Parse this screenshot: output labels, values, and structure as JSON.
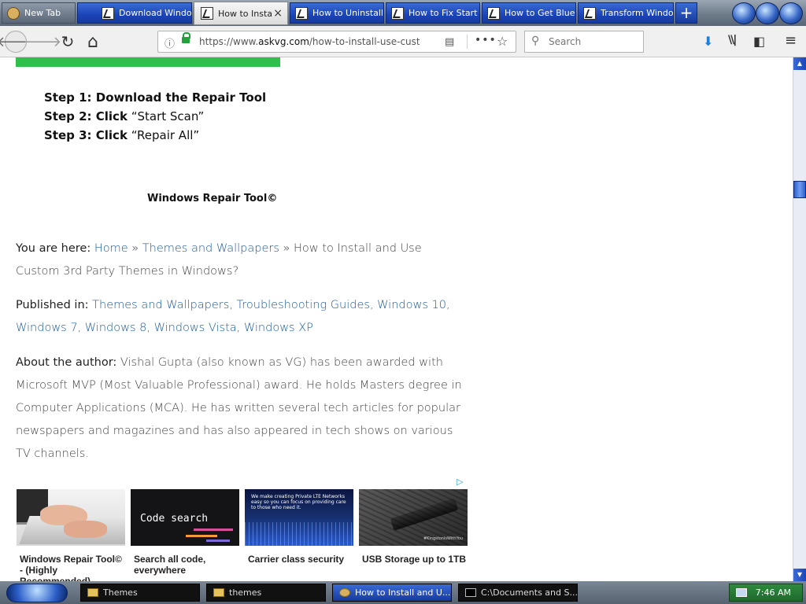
{
  "tabs": [
    {
      "title": "New Tab",
      "favicon": "firefox-icon",
      "state": "inactive-gray"
    },
    {
      "title": "Download Windo",
      "favicon": "askvg-icon",
      "state": "inactive"
    },
    {
      "title": "How to Insta",
      "favicon": "askvg-icon",
      "state": "active",
      "close": "×"
    },
    {
      "title": "How to Uninstall",
      "favicon": "askvg-icon",
      "state": "inactive"
    },
    {
      "title": "How to Fix Start",
      "favicon": "askvg-icon",
      "state": "inactive"
    },
    {
      "title": "How to Get Blue",
      "favicon": "askvg-icon",
      "state": "inactive"
    },
    {
      "title": "Transform Windo",
      "favicon": "askvg-icon",
      "state": "inactive"
    }
  ],
  "new_tab_symbol": "+",
  "nav": {
    "back": "🡐",
    "forward": "🡒",
    "reload": "↻",
    "home": "⌂",
    "url_prefix": "https://www.",
    "url_domain": "askvg.com",
    "url_path": "/how-to-install-use-cust",
    "search_placeholder": "Search",
    "download": "⬇",
    "library": "\\\\|",
    "sidebar": "◧",
    "menu": "≡",
    "more": "•••",
    "bookmark": "☆",
    "reader": "▤",
    "info": "ⓘ"
  },
  "content": {
    "steps": [
      {
        "bold": "Step 1: Download the Repair Tool",
        "normal": ""
      },
      {
        "bold": "Step 2: Click",
        "normal": " “Start Scan”"
      },
      {
        "bold": "Step 3: Click",
        "normal": " “Repair All”"
      }
    ],
    "repair_tool_label": "Windows Repair Tool©",
    "breadcrumb": {
      "label": "You are here:",
      "home": "Home",
      "sep": " » ",
      "category": "Themes and Wallpapers",
      "current": "How to Install and Use Custom 3rd Party Themes in Windows?"
    },
    "published": {
      "label": "Published in:",
      "links": [
        "Themes and Wallpapers",
        "Troubleshooting Guides",
        "Windows 10",
        "Windows 7",
        "Windows 8",
        "Windows Vista",
        "Windows XP"
      ]
    },
    "author": {
      "label": "About the author:",
      "text": "Vishal Gupta (also known as VG) has been awarded with Microsoft MVP (Most Valuable Professional) award. He holds Masters degree in Computer Applications (MCA). He has written several tech articles for popular newspapers and magazines and has also appeared in tech shows on various TV channels."
    },
    "ads": [
      {
        "caption": "Windows Repair Tool© - (Highly Recommended)",
        "image": "laptop-typing-image"
      },
      {
        "caption": "Search all code, everywhere",
        "image": "code-search-image",
        "overlay": "Code search"
      },
      {
        "caption": "Carrier class security",
        "image": "lte-network-image",
        "overlay": "We make creating Private LTE Networks easy so you can focus on providing care to those who need it."
      },
      {
        "caption": "USB Storage up to 1TB",
        "image": "usb-drive-image",
        "overlay": "#KingstonIsWithYou"
      }
    ]
  },
  "taskbar": {
    "items": [
      {
        "label": "Themes",
        "icon": "folder-icon",
        "active": false
      },
      {
        "label": "themes",
        "icon": "folder-icon",
        "active": false
      },
      {
        "label": "How to Install and U...",
        "icon": "firefox-icon",
        "active": true
      },
      {
        "label": "C:\\Documents and S...",
        "icon": "cmd-icon",
        "active": false
      }
    ],
    "clock": "7:46 AM"
  },
  "colors": {
    "accent_blue": "#1b44b8",
    "link": "#1a5a9c",
    "green_bar": "#2ec04a",
    "tray_green": "#1e6a2c"
  }
}
